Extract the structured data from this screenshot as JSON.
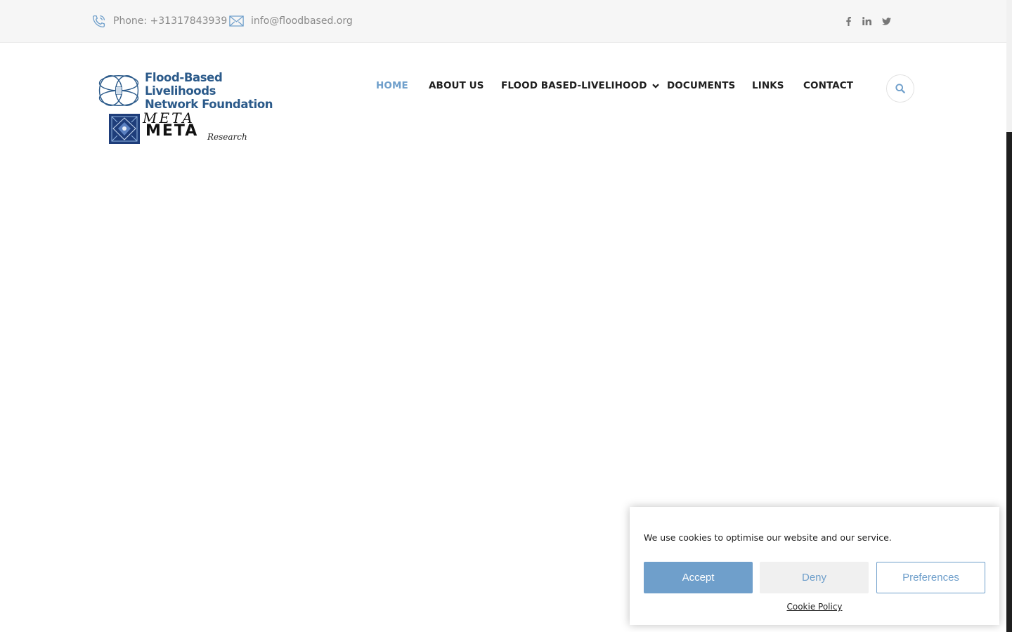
{
  "topbar": {
    "phone_label": "Phone: +31317843939",
    "email_label": "info@floodbased.org",
    "social": [
      "facebook-icon",
      "linkedin-icon",
      "twitter-icon"
    ]
  },
  "logo": {
    "line1": "Flood-Based Livelihoods",
    "line2": "Network Foundation",
    "partner_script": "META",
    "partner_word": "META",
    "partner_sub": "Research"
  },
  "nav": {
    "items": [
      {
        "label": "HOME",
        "active": true
      },
      {
        "label": "ABOUT US"
      },
      {
        "label": "FLOOD BASED-LIVELIHOOD",
        "has_dropdown": true
      },
      {
        "label": "DOCUMENTS"
      },
      {
        "label": "LINKS"
      },
      {
        "label": "CONTACT"
      }
    ],
    "search_icon": "search-icon"
  },
  "cookie": {
    "message": "We use cookies to optimise our website and our service.",
    "accept_label": "Accept",
    "deny_label": "Deny",
    "preferences_label": "Preferences",
    "policy_label": "Cookie Policy"
  },
  "colors": {
    "accent": "#6f9fcb",
    "topbar_bg": "#f6f6f6",
    "logo_blue": "#2b5a8a",
    "nav_text": "#1f1f1f"
  }
}
